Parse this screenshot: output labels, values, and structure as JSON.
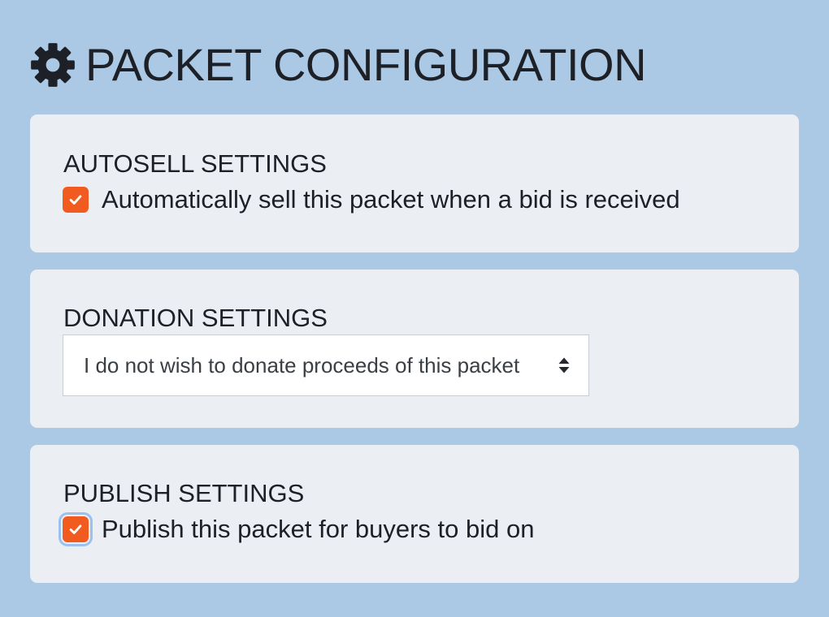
{
  "header": {
    "icon": "gear-icon",
    "title": "PACKET CONFIGURATION"
  },
  "autosell": {
    "title": "AUTOSELL SETTINGS",
    "checkbox_label": "Automatically sell this packet when a bid is received",
    "checked": true
  },
  "donation": {
    "title": "DONATION SETTINGS",
    "selected_option": "I do not wish to donate proceeds of this packet",
    "icon": "select-updown-icon"
  },
  "publish": {
    "title": "PUBLISH SETTINGS",
    "checkbox_label": "Publish this packet for buyers to bid on",
    "checked": true
  },
  "colors": {
    "background": "#abc9e5",
    "card": "#ebeff3",
    "accent": "#f25b1f",
    "focus_ring": "#9cc1ef",
    "text": "#1d2127"
  }
}
